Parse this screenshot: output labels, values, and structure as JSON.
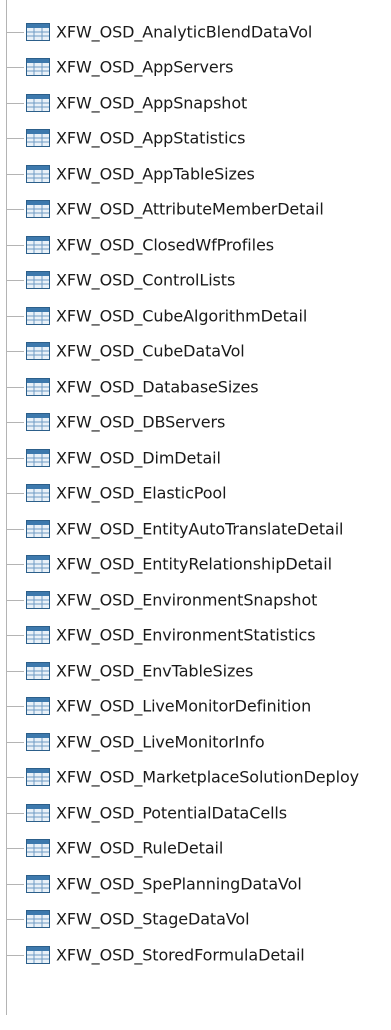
{
  "tree": {
    "icon": "table-icon",
    "items": [
      {
        "label": "XFW_OSD_AnalyticBlendDataVol"
      },
      {
        "label": "XFW_OSD_AppServers"
      },
      {
        "label": "XFW_OSD_AppSnapshot"
      },
      {
        "label": "XFW_OSD_AppStatistics"
      },
      {
        "label": "XFW_OSD_AppTableSizes"
      },
      {
        "label": "XFW_OSD_AttributeMemberDetail"
      },
      {
        "label": "XFW_OSD_ClosedWfProfiles"
      },
      {
        "label": "XFW_OSD_ControlLists"
      },
      {
        "label": "XFW_OSD_CubeAlgorithmDetail"
      },
      {
        "label": "XFW_OSD_CubeDataVol"
      },
      {
        "label": "XFW_OSD_DatabaseSizes"
      },
      {
        "label": "XFW_OSD_DBServers"
      },
      {
        "label": "XFW_OSD_DimDetail"
      },
      {
        "label": "XFW_OSD_ElasticPool"
      },
      {
        "label": "XFW_OSD_EntityAutoTranslateDetail"
      },
      {
        "label": "XFW_OSD_EntityRelationshipDetail"
      },
      {
        "label": "XFW_OSD_EnvironmentSnapshot"
      },
      {
        "label": "XFW_OSD_EnvironmentStatistics"
      },
      {
        "label": "XFW_OSD_EnvTableSizes"
      },
      {
        "label": "XFW_OSD_LiveMonitorDefinition"
      },
      {
        "label": "XFW_OSD_LiveMonitorInfo"
      },
      {
        "label": "XFW_OSD_MarketplaceSolutionDeploy"
      },
      {
        "label": "XFW_OSD_PotentialDataCells"
      },
      {
        "label": "XFW_OSD_RuleDetail"
      },
      {
        "label": "XFW_OSD_SpePlanningDataVol"
      },
      {
        "label": "XFW_OSD_StageDataVol"
      },
      {
        "label": "XFW_OSD_StoredFormulaDetail"
      }
    ]
  }
}
